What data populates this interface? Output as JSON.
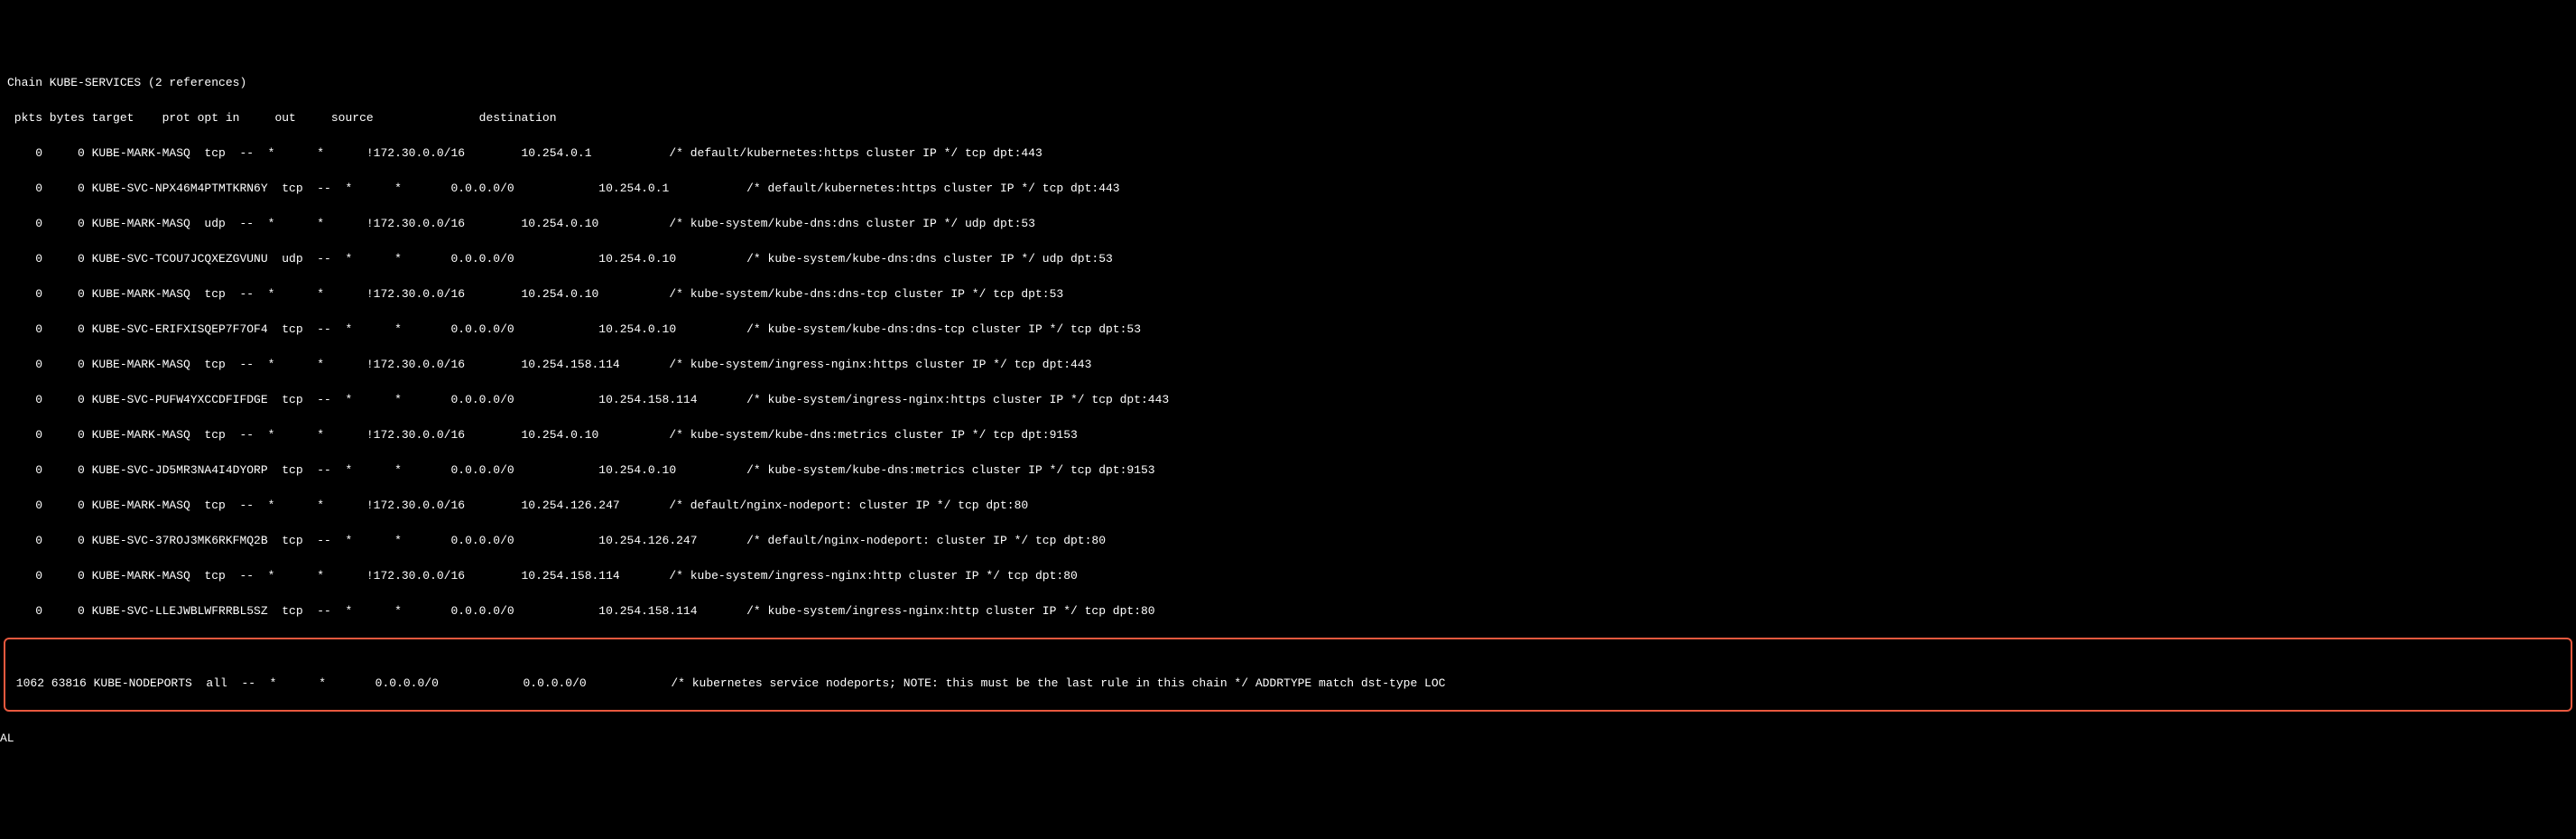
{
  "header": {
    "chain_line": "Chain KUBE-SERVICES (2 references)",
    "columns_line": " pkts bytes target    prot opt in     out     source               destination"
  },
  "rows": [
    "    0     0 KUBE-MARK-MASQ  tcp  --  *      *      !172.30.0.0/16        10.254.0.1           /* default/kubernetes:https cluster IP */ tcp dpt:443",
    "    0     0 KUBE-SVC-NPX46M4PTMTKRN6Y  tcp  --  *      *       0.0.0.0/0            10.254.0.1           /* default/kubernetes:https cluster IP */ tcp dpt:443",
    "    0     0 KUBE-MARK-MASQ  udp  --  *      *      !172.30.0.0/16        10.254.0.10          /* kube-system/kube-dns:dns cluster IP */ udp dpt:53",
    "    0     0 KUBE-SVC-TCOU7JCQXEZGVUNU  udp  --  *      *       0.0.0.0/0            10.254.0.10          /* kube-system/kube-dns:dns cluster IP */ udp dpt:53",
    "    0     0 KUBE-MARK-MASQ  tcp  --  *      *      !172.30.0.0/16        10.254.0.10          /* kube-system/kube-dns:dns-tcp cluster IP */ tcp dpt:53",
    "    0     0 KUBE-SVC-ERIFXISQEP7F7OF4  tcp  --  *      *       0.0.0.0/0            10.254.0.10          /* kube-system/kube-dns:dns-tcp cluster IP */ tcp dpt:53",
    "    0     0 KUBE-MARK-MASQ  tcp  --  *      *      !172.30.0.0/16        10.254.158.114       /* kube-system/ingress-nginx:https cluster IP */ tcp dpt:443",
    "    0     0 KUBE-SVC-PUFW4YXCCDFIFDGE  tcp  --  *      *       0.0.0.0/0            10.254.158.114       /* kube-system/ingress-nginx:https cluster IP */ tcp dpt:443",
    "    0     0 KUBE-MARK-MASQ  tcp  --  *      *      !172.30.0.0/16        10.254.0.10          /* kube-system/kube-dns:metrics cluster IP */ tcp dpt:9153",
    "    0     0 KUBE-SVC-JD5MR3NA4I4DYORP  tcp  --  *      *       0.0.0.0/0            10.254.0.10          /* kube-system/kube-dns:metrics cluster IP */ tcp dpt:9153",
    "    0     0 KUBE-MARK-MASQ  tcp  --  *      *      !172.30.0.0/16        10.254.126.247       /* default/nginx-nodeport: cluster IP */ tcp dpt:80",
    "    0     0 KUBE-SVC-37ROJ3MK6RKFMQ2B  tcp  --  *      *       0.0.0.0/0            10.254.126.247       /* default/nginx-nodeport: cluster IP */ tcp dpt:80",
    "    0     0 KUBE-MARK-MASQ  tcp  --  *      *      !172.30.0.0/16        10.254.158.114       /* kube-system/ingress-nginx:http cluster IP */ tcp dpt:80",
    "    0     0 KUBE-SVC-LLEJWBLWFRRBL5SZ  tcp  --  *      *       0.0.0.0/0            10.254.158.114       /* kube-system/ingress-nginx:http cluster IP */ tcp dpt:80"
  ],
  "highlighted_row": " 1062 63816 KUBE-NODEPORTS  all  --  *      *       0.0.0.0/0            0.0.0.0/0            /* kubernetes service nodeports; NOTE: this must be the last rule in this chain */ ADDRTYPE match dst-type LOC",
  "trailing_line": "AL"
}
